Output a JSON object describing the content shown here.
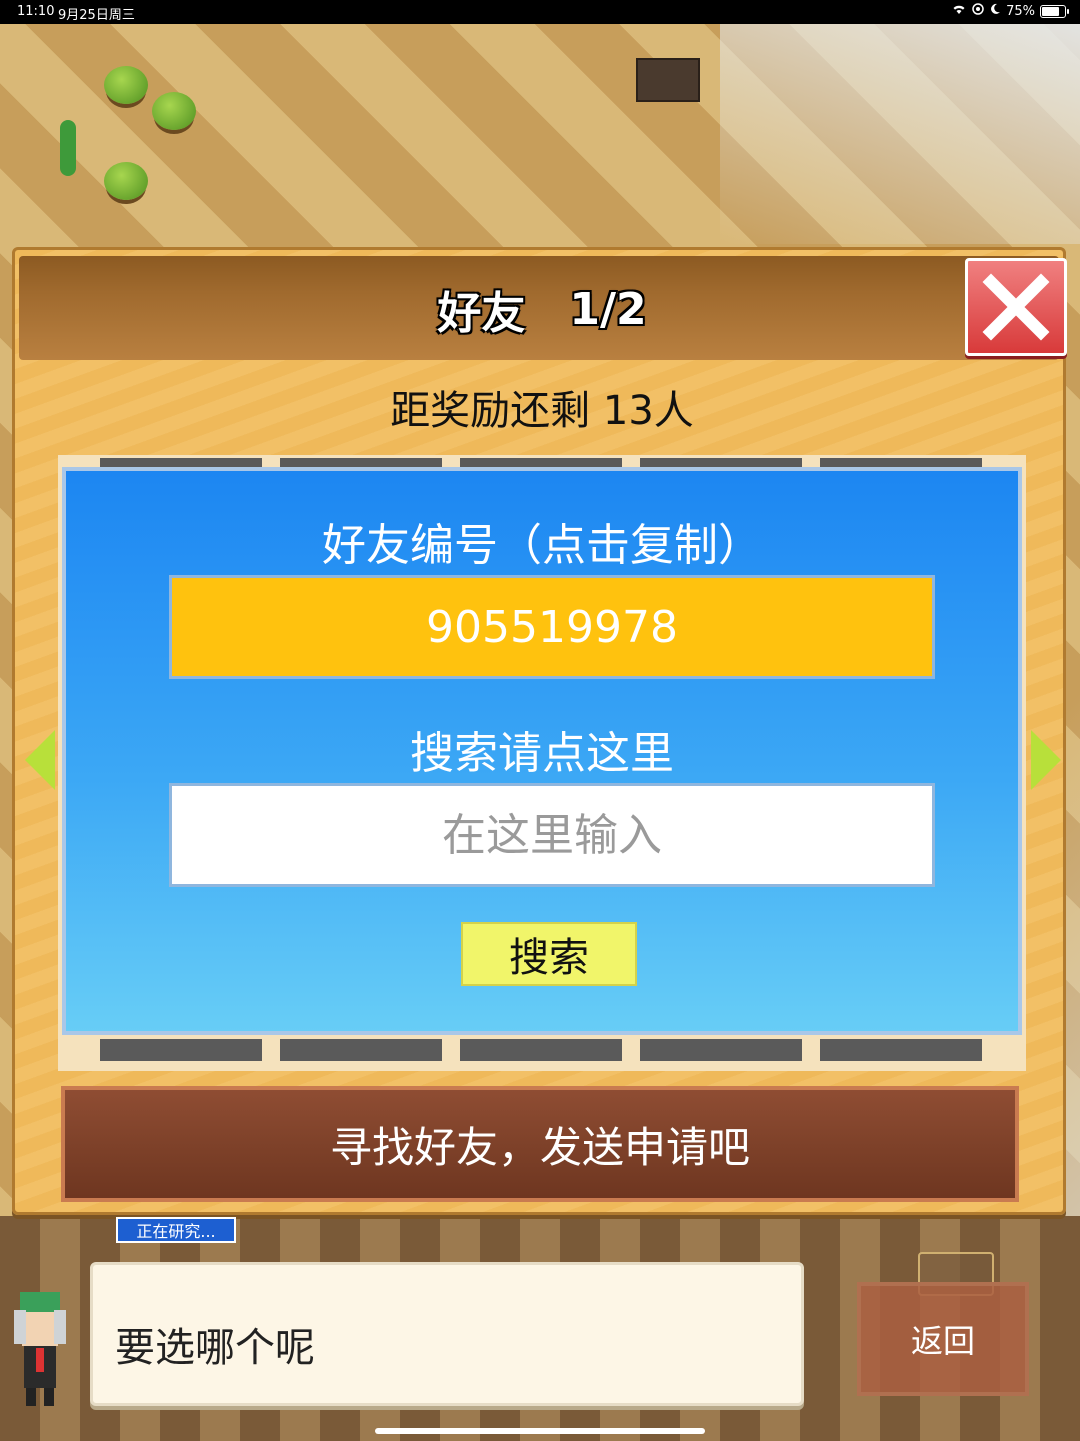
{
  "status_bar": {
    "time": "11:10",
    "date": "9月25日周三",
    "battery": "75%",
    "icons": [
      "wifi-icon",
      "location-icon",
      "moon-icon",
      "battery-icon"
    ]
  },
  "panel": {
    "title": "好友",
    "page": "1/2",
    "reward_text": "距奖励还剩 13人",
    "friend_id_label": "好友编号（点击复制）",
    "friend_id": "905519978",
    "search_label": "搜索请点这里",
    "search_placeholder": "在这里输入",
    "search_button": "搜索",
    "find_button": "寻找好友，发送申请吧"
  },
  "background": {
    "research_badge": "正在研究..."
  },
  "dialog": {
    "text": "要选哪个呢",
    "back_button": "返回"
  },
  "colors": {
    "panel": "#f0bb5e",
    "blue_box_top": "#1c86f2",
    "blue_box_bottom": "#67cdf6",
    "id_field": "#ffc20e",
    "search_button": "#f1f56a",
    "find_button": "#7e4129",
    "close_button": "#e04848"
  }
}
